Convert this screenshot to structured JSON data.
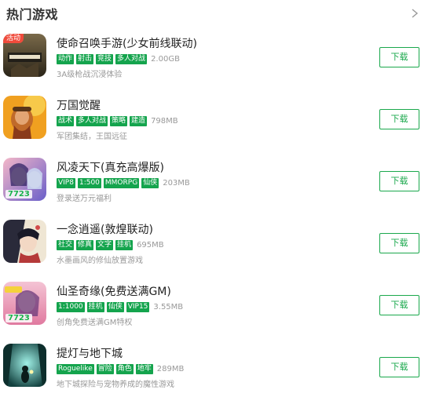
{
  "section": {
    "title": "热门游戏",
    "more_icon": "chevron-right-icon"
  },
  "download_label": "下载",
  "accent_color": "#14a44d",
  "games": [
    {
      "name": "使命召唤手游(少女前线联动)",
      "tags": [
        "动作",
        "射击",
        "竞技",
        "多人对战"
      ],
      "size": "2.00GB",
      "desc": "3A级枪战沉浸体验",
      "badge": "活动",
      "icon": "call-of-duty-game-icon",
      "icon_text": ""
    },
    {
      "name": "万国觉醒",
      "tags": [
        "战术",
        "多人对战",
        "策略",
        "建造"
      ],
      "size": "798MB",
      "desc": "军团集结，王国远征",
      "badge": "",
      "icon": "rise-of-kingdoms-game-icon",
      "icon_text": ""
    },
    {
      "name": "风凌天下(真充高爆版)",
      "tags": [
        "VIP8",
        "1:500",
        "MMORPG",
        "仙侠"
      ],
      "size": "203MB",
      "desc": "登录送万元福利",
      "badge": "",
      "icon": "fenglingtianxia-game-icon",
      "icon_text": "7723"
    },
    {
      "name": "一念逍遥(敦煌联动)",
      "tags": [
        "社交",
        "修真",
        "文字",
        "挂机"
      ],
      "size": "695MB",
      "desc": "水墨画风的修仙放置游戏",
      "badge": "",
      "icon": "yinianxiaoyao-game-icon",
      "icon_text": ""
    },
    {
      "name": "仙圣奇缘(免费送满GM)",
      "tags": [
        "1:1000",
        "挂机",
        "仙侠",
        "VIP15"
      ],
      "size": "3.55MB",
      "desc": "创角免费送满GM特权",
      "badge": "",
      "icon": "xianshengqiyuan-game-icon",
      "icon_text": "7723"
    },
    {
      "name": "提灯与地下城",
      "tags": [
        "Roguelike",
        "冒险",
        "角色",
        "地牢"
      ],
      "size": "289MB",
      "desc": "地下城探险与宠物养成的魔性游戏",
      "badge": "",
      "icon": "lantern-dungeon-game-icon",
      "icon_text": ""
    }
  ]
}
